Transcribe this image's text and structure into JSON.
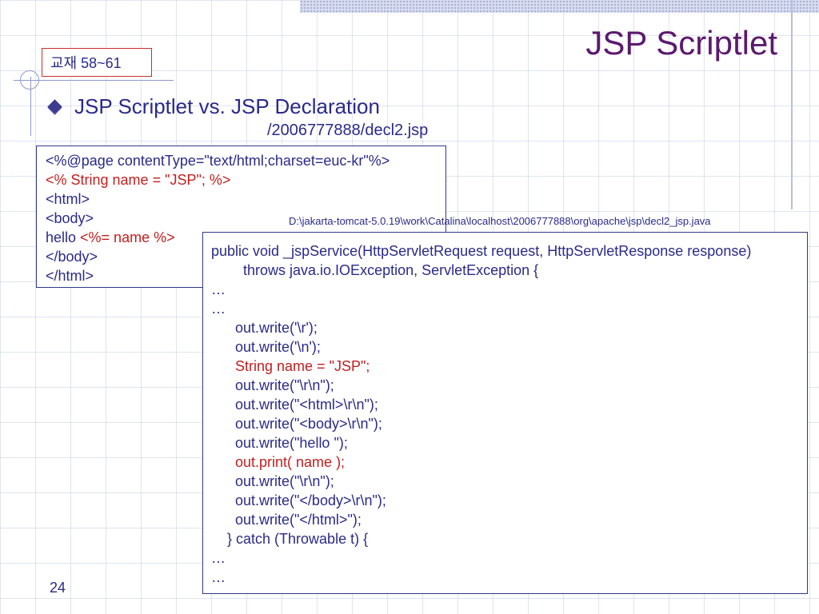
{
  "slide": {
    "title": "JSP Scriptlet",
    "reference": "교재 58~61",
    "bullet": "JSP Scriptlet vs. JSP Declaration",
    "filename": "/2006777888/decl2.jsp",
    "generated_path": "D:\\jakarta-tomcat-5.0.19\\work\\Catalina\\localhost\\2006777888\\org\\apache\\jsp\\decl2_jsp.java",
    "page_number": "24"
  },
  "jsp_source": {
    "l1": "<%@page contentType=\"text/html;charset=euc-kr\"%>",
    "l2": "<% String name = \"JSP\"; %>",
    "l3": "<html>",
    "l4": "<body>",
    "l5a": "hello ",
    "l5b": "<%= name %>",
    "l6": "</body>",
    "l7": "</html>"
  },
  "java_source": {
    "l1": "public void _jspService(HttpServletRequest request, HttpServletResponse response)",
    "l2": "        throws java.io.IOException, ServletException {",
    "l3": "…",
    "l4": "…",
    "l5": "      out.write('\\r');",
    "l6": "      out.write('\\n');",
    "l7": "      String name = \"JSP\";",
    "l8": "      out.write(\"\\r\\n\");",
    "l9": "      out.write(\"<html>\\r\\n\");",
    "l10": "      out.write(\"<body>\\r\\n\");",
    "l11": "      out.write(\"hello \");",
    "l12": "      out.print( name );",
    "l13": "      out.write(\"\\r\\n\");",
    "l14": "      out.write(\"</body>\\r\\n\");",
    "l15": "      out.write(\"</html>\");",
    "l16": "    } catch (Throwable t) {",
    "l17": "…",
    "l18": "…"
  },
  "colors": {
    "text": "#2a2a8a",
    "highlight": "#c41e1e",
    "title": "#5b1a6e",
    "box_border": "#2e3a8a",
    "ref_border": "#c9302c"
  },
  "icons": {
    "bullet": "diamond-bullet-icon"
  }
}
